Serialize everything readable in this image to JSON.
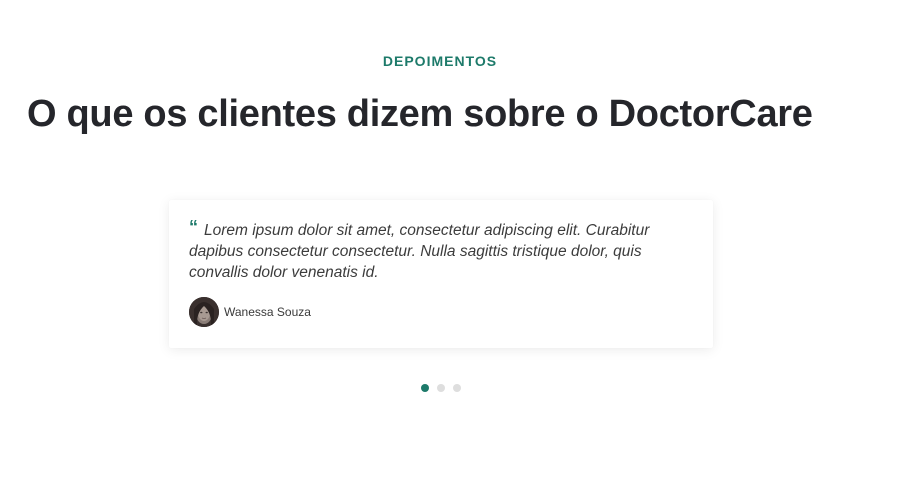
{
  "section": {
    "eyebrow": "DEPOIMENTOS",
    "title": "O que os clientes dizem sobre o DoctorCare"
  },
  "testimonial": {
    "quote_icon": "quote-icon",
    "text": "Lorem ipsum dolor sit amet, consectetur adipiscing elit. Curabitur dapibus consectetur consectetur. Nulla sagittis tristique dolor, quis convallis dolor venenatis id.",
    "author": "Wanessa Souza"
  },
  "carousel": {
    "active_index": 0,
    "count": 3
  },
  "colors": {
    "accent": "#1d7a6a",
    "heading": "#25262b",
    "dot_inactive": "#dedede"
  }
}
